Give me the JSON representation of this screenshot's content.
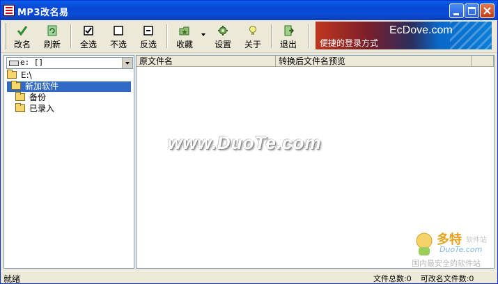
{
  "window": {
    "title": "MP3改名易"
  },
  "toolbar": {
    "buttons": [
      {
        "label": "改名",
        "icon": "check-icon"
      },
      {
        "label": "刷新",
        "icon": "refresh-icon"
      },
      {
        "label": "全选",
        "icon": "checkbox-checked-icon"
      },
      {
        "label": "不选",
        "icon": "checkbox-empty-icon"
      },
      {
        "label": "反选",
        "icon": "checkbox-invert-icon"
      },
      {
        "label": "收藏",
        "icon": "favorites-folder-icon"
      },
      {
        "label": "设置",
        "icon": "settings-icon"
      },
      {
        "label": "关于",
        "icon": "lightbulb-icon"
      },
      {
        "label": "退出",
        "icon": "exit-icon"
      }
    ]
  },
  "banner": {
    "brand": "EcDove.com",
    "slogan": "便捷的登录方式"
  },
  "drive_select": {
    "value": "e: []"
  },
  "tree": {
    "items": [
      "E:\\",
      "新加软件",
      "备份",
      "已录入"
    ]
  },
  "file_list": {
    "columns": [
      "原文件名",
      "转换后文件名预览"
    ]
  },
  "watermark": {
    "text": "www.DuoTe.com"
  },
  "corner_logo": {
    "brand": "多特",
    "sub": "软件站",
    "domain": "DuoTe.com",
    "slogan": "国内最安全的软件站"
  },
  "status": {
    "left": "就绪",
    "total": "文件总数:0",
    "renamable": "可改名文件数:0"
  },
  "colors": {
    "title_bar": "#0a4bd6",
    "selection": "#316ac5",
    "face": "#ece9d8"
  }
}
